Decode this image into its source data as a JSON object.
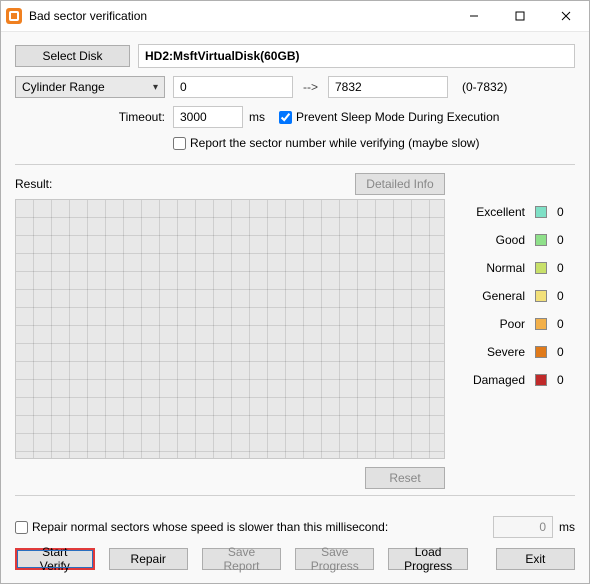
{
  "window": {
    "title": "Bad sector verification"
  },
  "toolbar": {
    "select_disk": "Select Disk",
    "disk_name": "HD2:MsftVirtualDisk(60GB)"
  },
  "range": {
    "mode": "Cylinder Range",
    "start": "0",
    "end": "7832",
    "hint": "(0-7832)"
  },
  "timeout": {
    "label": "Timeout:",
    "value": "3000",
    "unit": "ms"
  },
  "options": {
    "prevent_sleep": "Prevent Sleep Mode During Execution",
    "report_sector": "Report the sector number while verifying (maybe slow)"
  },
  "result": {
    "label": "Result:",
    "detailed_info": "Detailed Info",
    "reset": "Reset"
  },
  "legend": [
    {
      "label": "Excellent",
      "color": "#7fe0c6",
      "count": "0"
    },
    {
      "label": "Good",
      "color": "#8fe08a",
      "count": "0"
    },
    {
      "label": "Normal",
      "color": "#c8e06a",
      "count": "0"
    },
    {
      "label": "General",
      "color": "#f2e07a",
      "count": "0"
    },
    {
      "label": "Poor",
      "color": "#f2b04a",
      "count": "0"
    },
    {
      "label": "Severe",
      "color": "#e07a1a",
      "count": "0"
    },
    {
      "label": "Damaged",
      "color": "#c02a2a",
      "count": "0"
    }
  ],
  "repair_slow": {
    "label": "Repair normal sectors whose speed is slower than this millisecond:",
    "value": "0",
    "unit": "ms"
  },
  "buttons": {
    "start_verify": "Start Verify",
    "repair": "Repair",
    "save_report": "Save Report",
    "save_progress": "Save Progress",
    "load_progress": "Load Progress",
    "exit": "Exit"
  }
}
